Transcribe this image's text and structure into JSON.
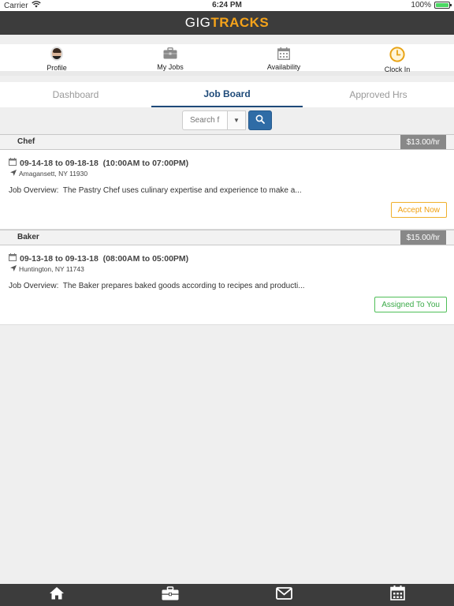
{
  "status_bar": {
    "carrier": "Carrier",
    "time": "6:24 PM",
    "battery": "100%",
    "battery_level": 1.0
  },
  "header": {
    "logo_gig": "GIG",
    "logo_tracks": "TRACKS"
  },
  "top_nav": [
    {
      "label": "Profile",
      "icon": "avatar"
    },
    {
      "label": "My Jobs",
      "icon": "briefcase-icon"
    },
    {
      "label": "Availability",
      "icon": "calendar-icon"
    },
    {
      "label": "Clock In",
      "icon": "clock-icon"
    }
  ],
  "tabs": [
    {
      "label": "Dashboard",
      "active": false
    },
    {
      "label": "Job Board",
      "active": true
    },
    {
      "label": "Approved Hrs",
      "active": false
    }
  ],
  "search": {
    "placeholder": "Search f"
  },
  "jobs": [
    {
      "title": "Chef",
      "rate": "$13.00/hr",
      "dates": "09-14-18 to 09-18-18  (10:00AM to 07:00PM)",
      "location": "Amagansett, NY 11930",
      "overview": "Job Overview:  The Pastry Chef uses culinary expertise and experience to make a...",
      "action": "Accept Now"
    },
    {
      "title": "Baker",
      "rate": "$15.00/hr",
      "dates": "09-13-18 to 09-13-18  (08:00AM to 05:00PM)",
      "location": "Huntington, NY 11743",
      "overview": "Job Overview:  The Baker prepares baked goods according to recipes and producti...",
      "action": "Assigned To You"
    }
  ],
  "bottom_bar": [
    "home-icon",
    "briefcase-icon",
    "envelope-icon",
    "calendar-icon"
  ],
  "colors": {
    "brand_orange": "#f5a31a",
    "header_dark": "#3c3c3c",
    "accent_blue": "#1e4a79",
    "accept_orange": "#f0a010",
    "assigned_green": "#3aaa47"
  }
}
